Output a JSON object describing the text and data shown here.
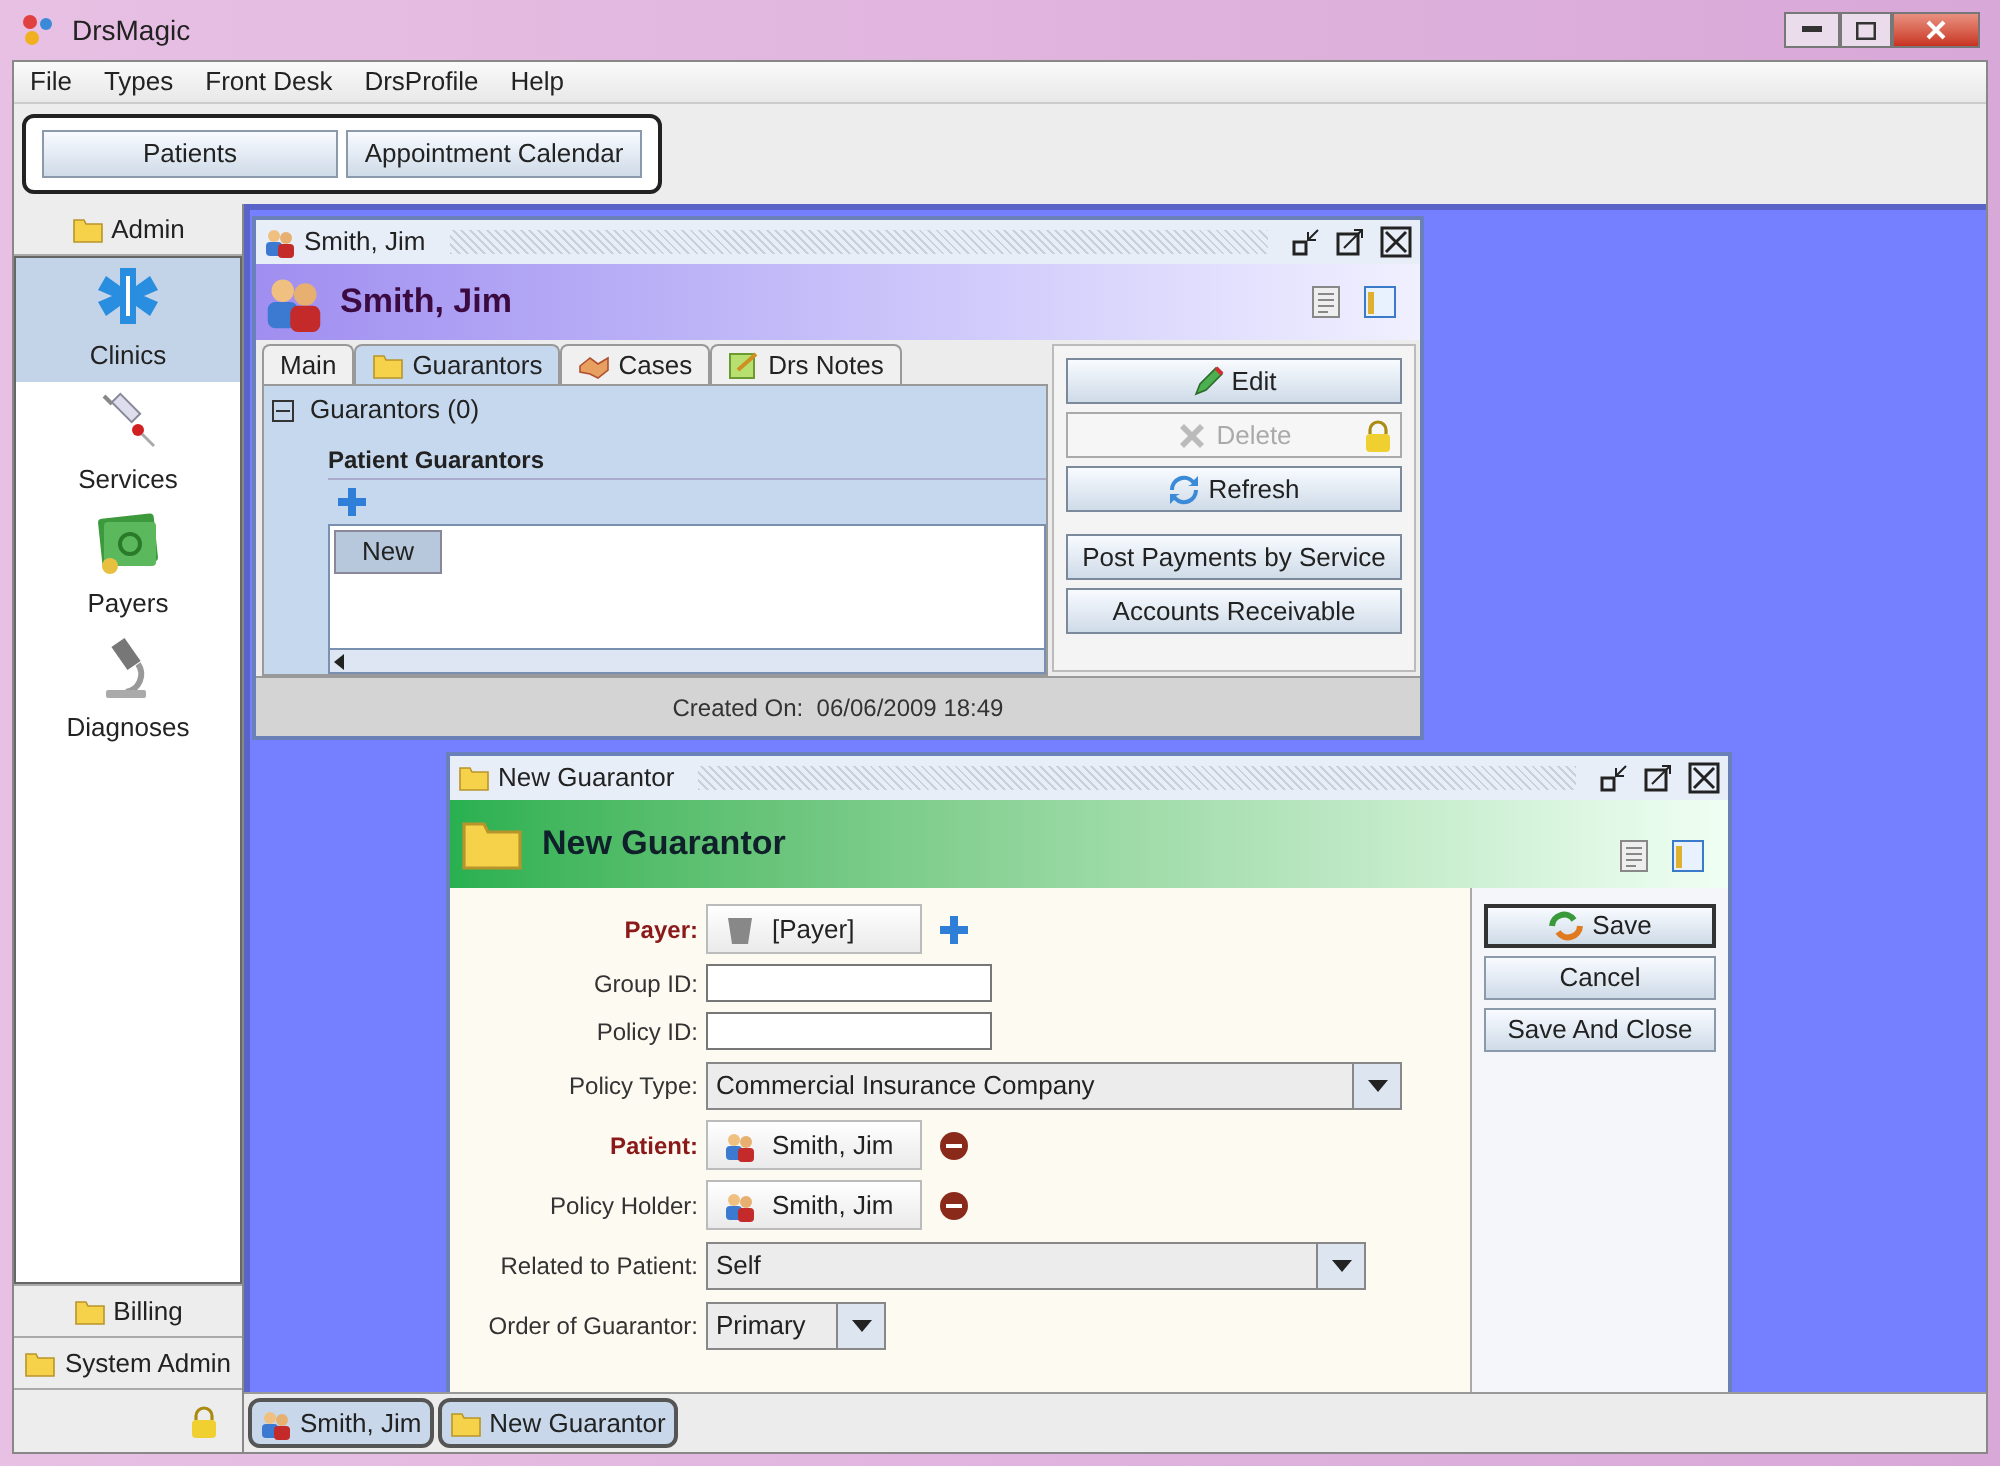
{
  "window": {
    "title": "DrsMagic"
  },
  "menu": [
    "File",
    "Types",
    "Front Desk",
    "DrsProfile",
    "Help"
  ],
  "toolbar": [
    "Patients",
    "Appointment Calendar"
  ],
  "sidebar": {
    "top_group": "Admin",
    "items": [
      {
        "label": "Clinics",
        "kind": "clinic",
        "selected": true
      },
      {
        "label": "Services",
        "kind": "syringe",
        "selected": false
      },
      {
        "label": "Payers",
        "kind": "money",
        "selected": false
      },
      {
        "label": "Diagnoses",
        "kind": "microscope",
        "selected": false
      }
    ],
    "bottom_groups": [
      "Billing",
      "System Admin"
    ]
  },
  "patient_window": {
    "title": "Smith, Jim",
    "heading": "Smith, Jim",
    "tabs": [
      {
        "label": "Main",
        "kind": "plain",
        "selected": false
      },
      {
        "label": "Guarantors",
        "kind": "folder",
        "selected": true
      },
      {
        "label": "Cases",
        "kind": "handshake",
        "selected": false
      },
      {
        "label": "Drs Notes",
        "kind": "notes",
        "selected": false
      }
    ],
    "tree_node": {
      "label": "Guarantors (0)",
      "expanded": true
    },
    "section": "Patient Guarantors",
    "list_items": [
      "New"
    ],
    "actions": [
      {
        "label": "Edit",
        "kind": "edit",
        "disabled": false
      },
      {
        "label": "Delete",
        "kind": "delete",
        "disabled": true
      },
      {
        "label": "Refresh",
        "kind": "refresh",
        "disabled": false
      },
      {
        "label": "Post Payments by Service",
        "kind": "plain",
        "disabled": false
      },
      {
        "label": "Accounts Receivable",
        "kind": "plain",
        "disabled": false
      }
    ],
    "status": "Created On:  06/06/2009 18:49"
  },
  "guarantor_window": {
    "title": "New Guarantor",
    "heading": "New Guarantor",
    "fields": [
      {
        "label": "Payer:",
        "kind": "picker_add",
        "required": true,
        "value": "[Payer]"
      },
      {
        "label": "Group ID:",
        "kind": "text",
        "required": false
      },
      {
        "label": "Policy ID:",
        "kind": "text",
        "required": false
      },
      {
        "label": "Policy Type:",
        "kind": "select",
        "required": false,
        "value": "Commercial Insurance Company"
      },
      {
        "label": "Patient:",
        "kind": "picker_remove",
        "required": true,
        "value": "Smith, Jim"
      },
      {
        "label": "Policy Holder:",
        "kind": "picker_remove",
        "required": false,
        "value": "Smith, Jim"
      },
      {
        "label": "Related to Patient:",
        "kind": "select",
        "required": false,
        "value": "Self"
      },
      {
        "label": "Order of Guarantor:",
        "kind": "select",
        "required": false,
        "value": "Primary"
      }
    ],
    "actions": [
      {
        "label": "Save",
        "kind": "save"
      },
      {
        "label": "Cancel",
        "kind": "plain"
      },
      {
        "label": "Save And Close",
        "kind": "plain"
      }
    ]
  },
  "taskbar": [
    {
      "label": "Smith, Jim",
      "kind": "people"
    },
    {
      "label": "New Guarantor",
      "kind": "folder"
    }
  ]
}
